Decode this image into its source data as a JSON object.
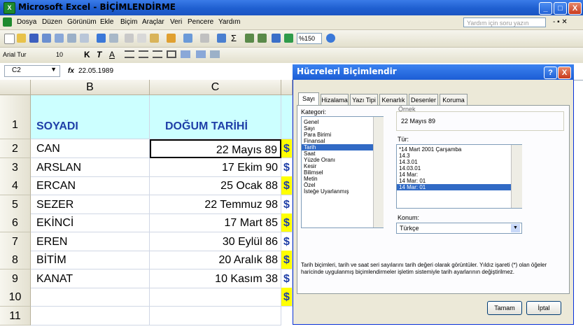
{
  "window": {
    "app_icon": "excel-icon",
    "title": "Microsoft Excel - BİÇİMLENDİRME",
    "min": "_",
    "max": "□",
    "close": "X"
  },
  "menu": {
    "items": [
      "Dosya",
      "Düzen",
      "Görünüm",
      "Ekle",
      "Biçim",
      "Araçlar",
      "Veri",
      "Pencere",
      "Yardım"
    ],
    "help_placeholder": "Yardım için soru yazın",
    "doc_controls": "- ▪ ✕"
  },
  "toolbar": {
    "zoom": "%150",
    "font_name": "Arial Tur",
    "font_size": "10",
    "bold": "K",
    "italic": "T",
    "underline": "A"
  },
  "formula": {
    "cell_ref": "C2",
    "fx": "fx",
    "value": "22.05.1989"
  },
  "sheet": {
    "col_b": "B",
    "col_c": "C",
    "rows": [
      {
        "n": "1",
        "b": "SOYADI",
        "c": "DOĞUM TARİHİ"
      },
      {
        "n": "2",
        "b": "CAN",
        "c": "22 Mayıs 89"
      },
      {
        "n": "3",
        "b": "ARSLAN",
        "c": "17 Ekim 90"
      },
      {
        "n": "4",
        "b": "ERCAN",
        "c": "25 Ocak 88"
      },
      {
        "n": "5",
        "b": "SEZER",
        "c": "22 Temmuz 98"
      },
      {
        "n": "6",
        "b": "EKİNCİ",
        "c": "17 Mart 85"
      },
      {
        "n": "7",
        "b": "EREN",
        "c": "30 Eylül 86"
      },
      {
        "n": "8",
        "b": "BİTİM",
        "c": "20 Aralık 88"
      },
      {
        "n": "9",
        "b": "KANAT",
        "c": "10 Kasım 38"
      },
      {
        "n": "10",
        "b": "",
        "c": ""
      },
      {
        "n": "11",
        "b": "",
        "c": ""
      }
    ],
    "dollar": "$"
  },
  "colors": {
    "header_fill": "#ccffff",
    "header_text": "#1f3fa8",
    "dollar_fill": "#ffff00",
    "selection": "#316ac5"
  },
  "dialog": {
    "title": "Hücreleri Biçimlendir",
    "tabs": [
      "Sayı",
      "Hizalama",
      "Yazı Tipi",
      "Kenarlık",
      "Desenler",
      "Koruma"
    ],
    "category_label": "Kategori:",
    "categories": [
      "Genel",
      "Sayı",
      "Para Birimi",
      "Finansal",
      "Tarih",
      "Saat",
      "Yüzde Oranı",
      "Kesir",
      "Bilimsel",
      "Metin",
      "Özel",
      "İsteğe Uyarlanmış"
    ],
    "selected_category": "Tarih",
    "sample_label": "Örnek",
    "sample_value": "22 Mayıs 89",
    "type_label": "Tür:",
    "types": [
      "*14 Mart 2001 Çarşamba",
      "14.3",
      "14.3.01",
      "14.03.01",
      "14 Mar:",
      "14 Mar: 01",
      "14 Mar: 01"
    ],
    "selected_type": "14 Mar: 01",
    "locale_label": "Konum:",
    "locale_value": "Türkçe",
    "description": "Tarih biçimleri, tarih ve saat seri sayılarını tarih değeri olarak görüntüler. Yıldız işareti (*) olan öğeler haricinde uygulanmış biçimlendirmeler işletim sistemiyle tarih ayarlarının değiştirilmez.",
    "ok": "Tamam",
    "cancel": "İptal",
    "help": "?",
    "close": "X"
  }
}
